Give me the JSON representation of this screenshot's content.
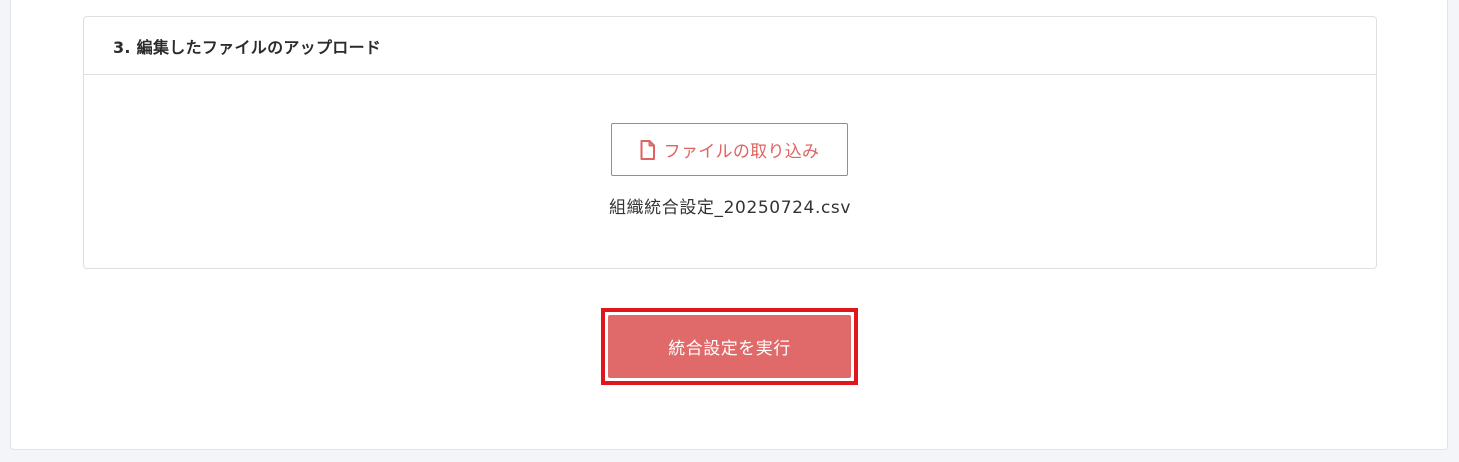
{
  "section": {
    "title": "3. 編集したファイルのアップロード"
  },
  "import": {
    "button_label": "ファイルの取り込み",
    "icon": "file-icon"
  },
  "file": {
    "name": "組織統合設定_20250724.csv"
  },
  "actions": {
    "execute_label": "統合設定を実行"
  },
  "colors": {
    "accent": "#e06a69",
    "highlight": "#e0161d",
    "background": "#f3f5f9"
  }
}
